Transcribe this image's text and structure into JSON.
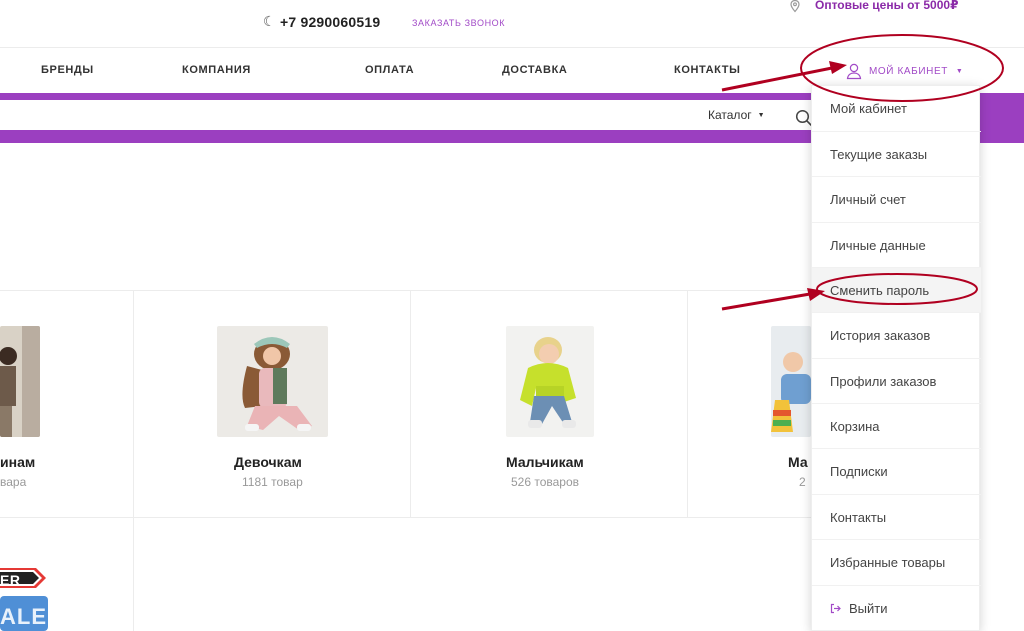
{
  "topbar": {
    "phone": "+7 9290060519",
    "callback": "ЗАКАЗАТЬ ЗВОНОК",
    "promo": "Оптовые цены от 5000₽"
  },
  "nav": {
    "items": [
      "БРЕНДЫ",
      "КОМПАНИЯ",
      "ОПЛАТА",
      "ДОСТАВКА",
      "КОНТАКТЫ"
    ],
    "account_label": "МОЙ КАБИНЕТ"
  },
  "search": {
    "catalog_label": "Каталог"
  },
  "categories": [
    {
      "title": "инам",
      "count": "вара"
    },
    {
      "title": "Девочкам",
      "count": "1181 товар"
    },
    {
      "title": "Мальчикам",
      "count": "526 товаров"
    },
    {
      "title": "Ма",
      "count": "2"
    }
  ],
  "sale_badge": {
    "line1": "ER",
    "line2": "ALE"
  },
  "dropdown": {
    "items": [
      "Мой кабинет",
      "Текущие заказы",
      "Личный счет",
      "Личные данные",
      "Сменить пароль",
      "История заказов",
      "Профили заказов",
      "Корзина",
      "Подписки",
      "Контакты",
      "Избранные товары",
      "Выйти"
    ]
  },
  "colors": {
    "accent": "#9b3fc0",
    "accent_text": "#a24bc7",
    "annotation": "#b00020"
  },
  "icons": [
    "phone-icon",
    "location-pin-icon",
    "user-icon",
    "search-icon",
    "logout-icon"
  ]
}
